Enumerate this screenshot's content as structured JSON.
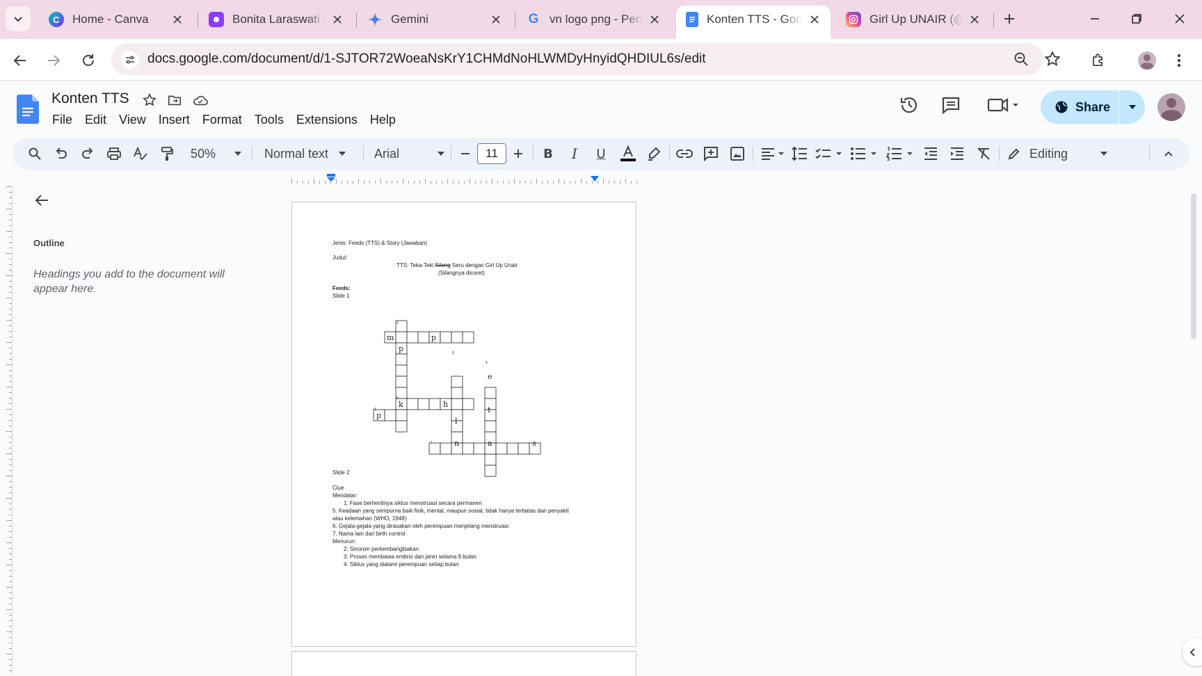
{
  "browser": {
    "tabs": [
      {
        "title": "Home - Canva",
        "favicon": "canva-icon",
        "color": "#7d2ae8"
      },
      {
        "title": "Bonita Laraswati W",
        "favicon": "canva-presentation-icon",
        "color": "#8b3dff"
      },
      {
        "title": "Gemini",
        "favicon": "gemini-icon",
        "color": "#4285f4"
      },
      {
        "title": "vn logo png - Pene",
        "favicon": "google-icon",
        "color": "#4285f4"
      },
      {
        "title": "Konten TTS - Goog",
        "favicon": "docs-icon",
        "color": "#4285f4",
        "active": true
      },
      {
        "title": "Girl Up UNAIR (@g",
        "favicon": "instagram-icon",
        "color": "#e1306c"
      }
    ],
    "url": "docs.google.com/document/d/1-SJTOR72WoeaNsKrY1CHMdNoHLWMDyHnyidQHDIUL6s/edit"
  },
  "doc": {
    "title": "Konten TTS",
    "menu": [
      "File",
      "Edit",
      "View",
      "Insert",
      "Format",
      "Tools",
      "Extensions",
      "Help"
    ],
    "share_label": "Share"
  },
  "toolbar": {
    "zoom": "50%",
    "style": "Normal text",
    "font": "Arial",
    "font_size": "11",
    "mode": "Editing"
  },
  "outline": {
    "label": "Outline",
    "hint": "Headings you add to the document will appear here."
  },
  "page": {
    "line1": "Jenis: Feeds (TTS) & Story (Jawaban)",
    "judul_label": "Judul:",
    "title_line1_a": "TTS: Teka-Teki ",
    "title_line1_strike": "Silang",
    "title_line1_b": " Seru dengan Girl Up Unair",
    "title_line2": "(Silangnya dicoret)",
    "feeds_label": "Feeds:",
    "slide1": "Slide 1",
    "slide2": "Slide 2",
    "clue": "Clue",
    "mendatar": "Mendatar:",
    "m1": "1.   Fase berhentinya siklus menstruasi secara permanen",
    "m5a": "5. Keadaan yang sempurna baik fisik, mental, maupun sosial, tidak hanya terbatas dari penyakit",
    "m5b": "atau kelemahan (WHO, 1948)",
    "m6": "6. Gejala-gejala yang dirasakan oleh perempuan menjelang menstruasi",
    "m7": "7. Nama lain dari birth control",
    "menurun": "Menurun:",
    "d2": "2.   Sinonim perkembangbiakan",
    "d3": "3.   Proses membawa embrio dan janin selama 9 bulan",
    "d4": "4.   Siklus yang dialami perempuan setiap bulan"
  },
  "crossword": {
    "letters": [
      "m",
      "p",
      "p",
      "k",
      "h",
      "e",
      "t",
      "l",
      "n",
      "a",
      "s"
    ],
    "numbers": [
      "2",
      "3",
      "4",
      "5",
      "6",
      "7"
    ]
  }
}
